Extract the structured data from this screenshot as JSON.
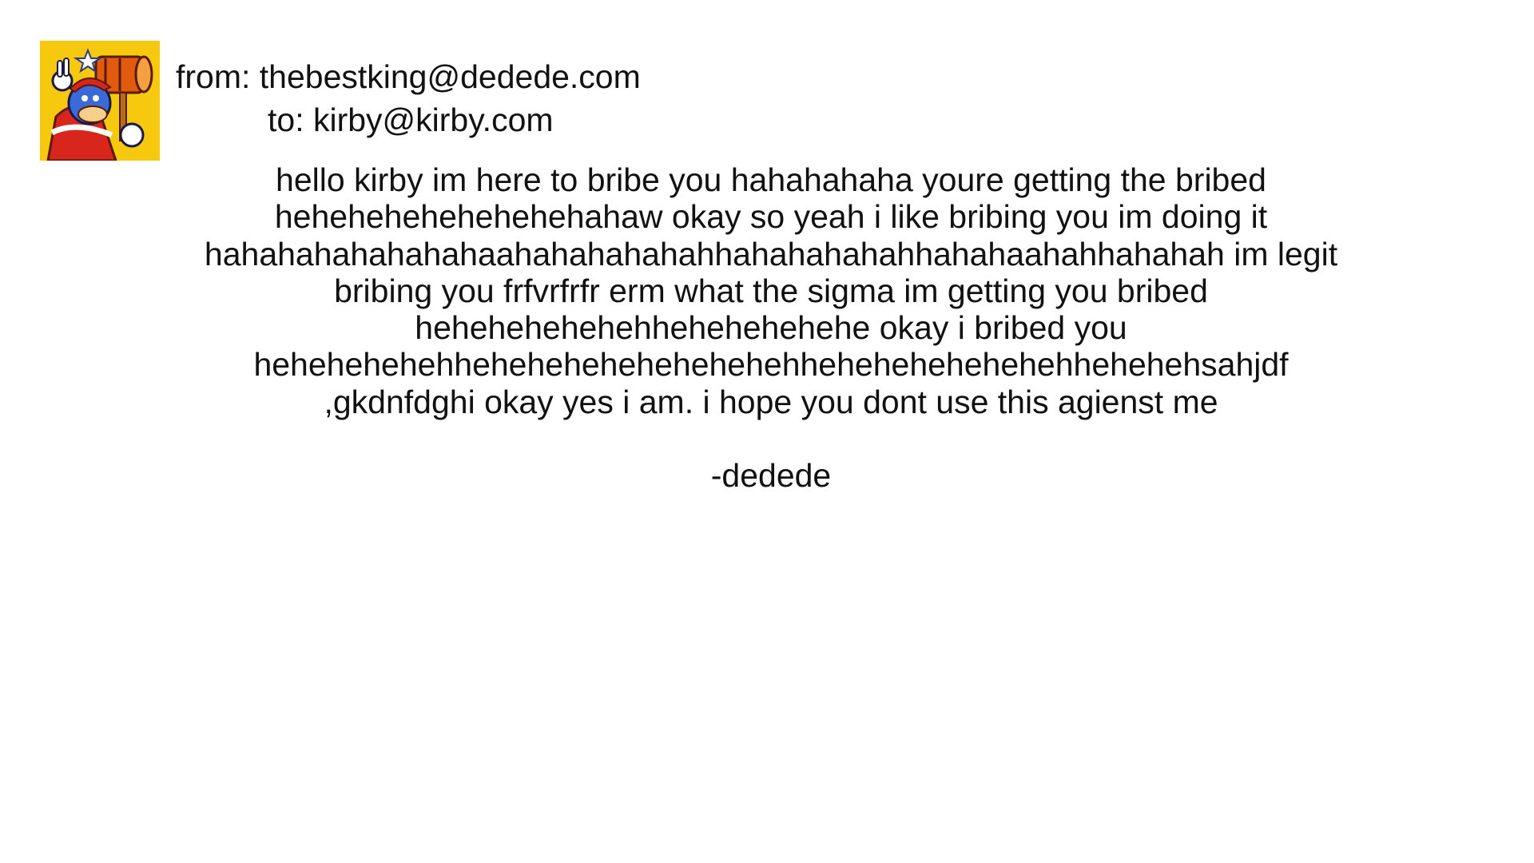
{
  "email": {
    "from_line": "from: thebestking@dedede.com",
    "to_line": "to: kirby@kirby.com",
    "body_lines": [
      "hello kirby im here to bribe you hahahahaha youre getting the bribed",
      "hehehehehehehehehahaw okay so yeah i like bribing you im doing it",
      "hahahahahahahahaahahahahahahhahahahahahhahahaahahhahahah im legit",
      "bribing you frfvrfrfr erm what the sigma im getting you bribed",
      "hehehehehehehhehehehehehe okay i bribed you",
      "hehehehehehhehehehehehehehehehhehehehehehehehhehehehsahjdf",
      ",gkdnfdghi okay yes i am. i hope you dont use this agienst me"
    ],
    "signature": "-dedede"
  },
  "avatar": {
    "icon": "king-dedede-avatar-icon",
    "background_color": "#f6c90e"
  }
}
